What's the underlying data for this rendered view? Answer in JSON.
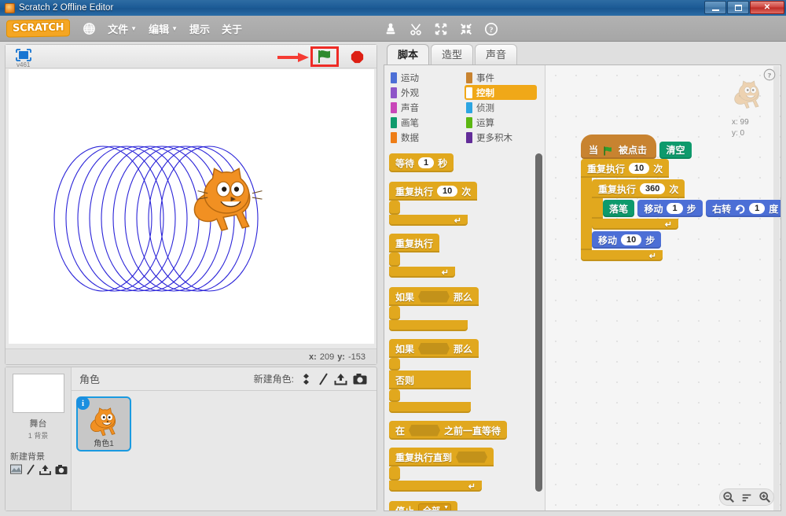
{
  "window": {
    "title": "Scratch 2 Offline Editor",
    "buttons": {
      "minimize": "minimize-icon",
      "maximize": "maximize-icon",
      "close": "✕"
    }
  },
  "menubar": {
    "logo": "SCRATCH",
    "globe_icon": "globe-icon",
    "items": [
      {
        "label": "文件",
        "has_caret": true
      },
      {
        "label": "编辑",
        "has_caret": true
      },
      {
        "label": "提示",
        "has_caret": false
      },
      {
        "label": "关于",
        "has_caret": false
      }
    ],
    "tools": [
      "stamp-icon",
      "scissors-icon",
      "grow-icon",
      "shrink-icon",
      "help-icon"
    ]
  },
  "stage": {
    "fullscreen_icon": "fullscreen-icon",
    "version": "v461",
    "green_flag_icon": "green-flag-icon",
    "stop_icon": "stop-sign-icon",
    "annotation": "red-arrow-pointing-to-green-flag",
    "mouse_x_label": "x:",
    "mouse_x": "209",
    "mouse_y_label": "y:",
    "mouse_y": "-153",
    "drawing": "blue-spiral-coil-10-circles",
    "sprite_cat": "scratch-cat"
  },
  "sprite_pane": {
    "title": "角色",
    "new_sprite_label": "新建角色:",
    "new_sprite_icons": [
      "library-icon",
      "paint-icon",
      "upload-icon",
      "camera-icon"
    ],
    "stage_label": "舞台",
    "stage_backdrops": "1 背景",
    "new_backdrop_label": "新建背景",
    "new_backdrop_icons": [
      "library-icon",
      "paint-icon",
      "upload-icon",
      "camera-icon"
    ],
    "sprites": [
      {
        "name": "角色1",
        "badge": "i",
        "selected": true
      }
    ]
  },
  "editor": {
    "tabs": [
      {
        "label": "脚本",
        "active": true
      },
      {
        "label": "造型",
        "active": false
      },
      {
        "label": "声音",
        "active": false
      }
    ],
    "help_icon": "help-icon",
    "watermark": {
      "x_label": "x: 99",
      "y_label": "y: 0"
    },
    "zoom_controls": [
      "zoom-out-icon",
      "zoom-reset-icon",
      "zoom-in-icon"
    ]
  },
  "palette": {
    "categories_left": [
      {
        "label": "运动",
        "color": "#4c6fd6",
        "selected": false
      },
      {
        "label": "外观",
        "color": "#8e55c8",
        "selected": false
      },
      {
        "label": "声音",
        "color": "#c946b9",
        "selected": false
      },
      {
        "label": "画笔",
        "color": "#0e9a6c",
        "selected": false
      },
      {
        "label": "数据",
        "color": "#ee7d16",
        "selected": false
      }
    ],
    "categories_right": [
      {
        "label": "事件",
        "color": "#c88330",
        "selected": false
      },
      {
        "label": "控制",
        "color": "#e1a81e",
        "selected": true
      },
      {
        "label": "侦测",
        "color": "#2ca5e2",
        "selected": false
      },
      {
        "label": "运算",
        "color": "#5cb712",
        "selected": false
      },
      {
        "label": "更多积木",
        "color": "#632d99",
        "selected": false
      }
    ],
    "blocks": [
      {
        "type": "stack",
        "parts": [
          {
            "t": "text",
            "v": "等待"
          },
          {
            "t": "oval",
            "v": "1"
          },
          {
            "t": "text",
            "v": "秒"
          }
        ]
      },
      {
        "type": "c",
        "parts": [
          {
            "t": "text",
            "v": "重复执行"
          },
          {
            "t": "oval",
            "v": "10"
          },
          {
            "t": "text",
            "v": "次"
          }
        ]
      },
      {
        "type": "c",
        "parts": [
          {
            "t": "text",
            "v": "重复执行"
          }
        ]
      },
      {
        "type": "c",
        "parts": [
          {
            "t": "text",
            "v": "如果"
          },
          {
            "t": "hex",
            "v": ""
          },
          {
            "t": "text",
            "v": "那么"
          }
        ]
      },
      {
        "type": "ce",
        "parts": [
          {
            "t": "text",
            "v": "如果"
          },
          {
            "t": "hex",
            "v": ""
          },
          {
            "t": "text",
            "v": "那么"
          }
        ],
        "else_label": "否则"
      },
      {
        "type": "stack",
        "parts": [
          {
            "t": "text",
            "v": "在"
          },
          {
            "t": "hex",
            "v": ""
          },
          {
            "t": "text",
            "v": "之前一直等待"
          }
        ]
      },
      {
        "type": "c",
        "parts": [
          {
            "t": "text",
            "v": "重复执行直到"
          },
          {
            "t": "hex",
            "v": ""
          }
        ]
      },
      {
        "type": "stack",
        "parts": [
          {
            "t": "text",
            "v": "停止"
          },
          {
            "t": "dropdown",
            "v": "全部"
          }
        ]
      }
    ]
  },
  "script": {
    "hat": {
      "pre": "当",
      "icon": "green-flag-icon",
      "post": "被点击",
      "color": "events"
    },
    "clear": {
      "label": "清空",
      "color": "pen"
    },
    "outer_loop": {
      "pre": "重复执行",
      "count": "10",
      "post": "次",
      "color": "ctrl"
    },
    "inner_loop": {
      "pre": "重复执行",
      "count": "360",
      "post": "次",
      "color": "ctrl"
    },
    "pen_down": {
      "label": "落笔",
      "color": "pen"
    },
    "move_1": {
      "pre": "移动",
      "count": "1",
      "post": "步",
      "color": "motion"
    },
    "turn_right": {
      "pre": "右转",
      "icon": "turn-right-icon",
      "count": "1",
      "post": "度",
      "color": "motion"
    },
    "move_10": {
      "pre": "移动",
      "count": "10",
      "post": "步",
      "color": "motion"
    }
  }
}
